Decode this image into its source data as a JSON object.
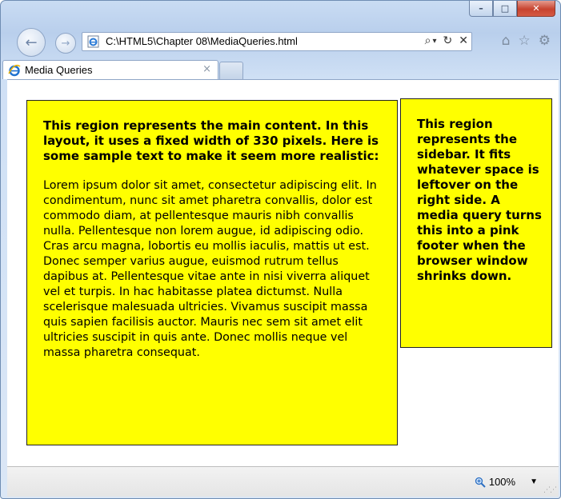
{
  "window": {
    "minimize_label": "–",
    "maximize_label": "□",
    "close_label": "✕"
  },
  "address_bar": {
    "url": "C:\\HTML5\\Chapter 08\\MediaQueries.html",
    "search_glyph": "⌕",
    "dropdown_glyph": "▾",
    "refresh_glyph": "↻",
    "stop_glyph": "✕"
  },
  "toolbar_icons": [
    "home-icon",
    "favorites-star-icon",
    "gear-icon"
  ],
  "tab": {
    "title": "Media Queries",
    "close_glyph": "×"
  },
  "page": {
    "main_heading": "This region represents the main content. In this layout, it uses a fixed width of 330 pixels. Here is some sample text to make it seem more realistic:",
    "main_body": "Lorem ipsum dolor sit amet, consectetur adipiscing elit. In condimentum, nunc sit amet pharetra convallis, dolor est commodo diam, at pellentesque mauris nibh convallis nulla. Pellentesque non lorem augue, id adipiscing odio. Cras arcu magna, lobortis eu mollis iaculis, mattis ut est. Donec semper varius augue, euismod rutrum tellus dapibus at. Pellentesque vitae ante in nisi viverra aliquet vel et turpis. In hac habitasse platea dictumst. Nulla scelerisque malesuada ultricies. Vivamus suscipit massa quis sapien facilisis auctor. Mauris nec sem sit amet elit ultricies suscipit in quis ante. Donec mollis neque vel massa pharetra consequat.",
    "sidebar_text": "This region represents the sidebar. It fits whatever space is leftover on the right side. A media query turns this into a pink footer when the browser window shrinks down.",
    "box_color": "#ffff00"
  },
  "status_bar": {
    "zoom": "100%",
    "zoom_dropdown_glyph": "▼"
  }
}
